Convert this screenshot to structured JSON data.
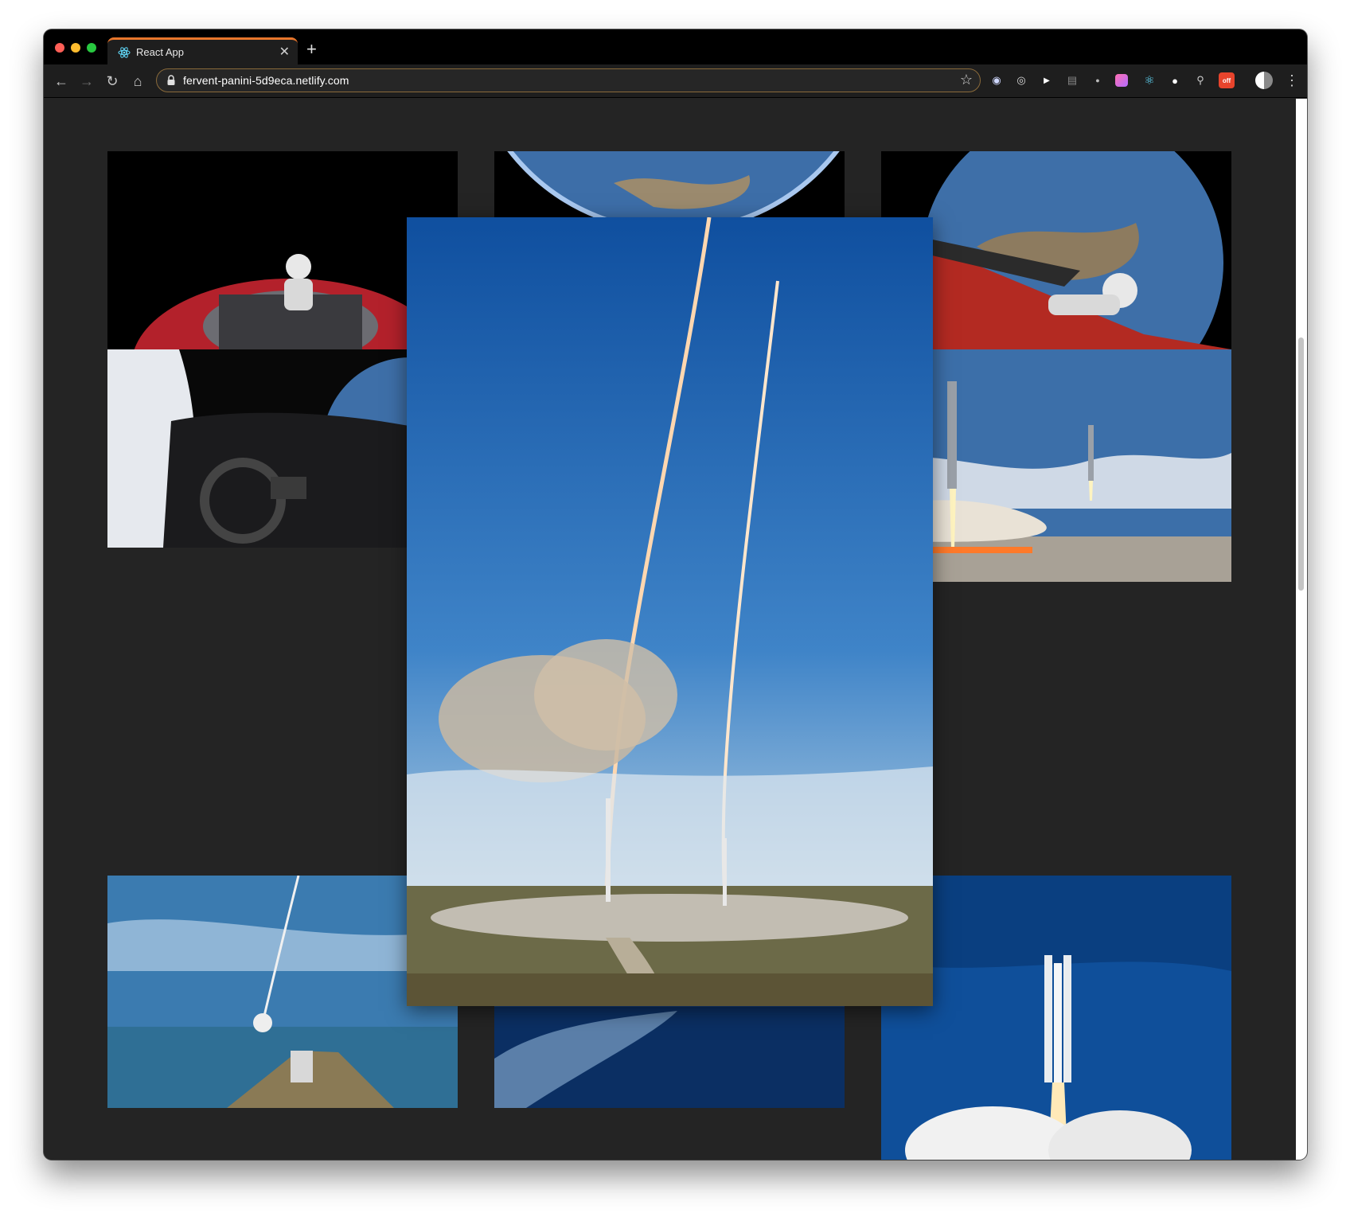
{
  "browser": {
    "tab": {
      "title": "React App",
      "close": "✕"
    },
    "new_tab": "+",
    "url": "fervent-panini-5d9eca.netlify.com",
    "nav": {
      "back": "←",
      "forward": "→",
      "reload": "↻",
      "home": "⌂",
      "bookmark": "☆",
      "menu": "⋮"
    },
    "extensions": [
      {
        "name": "owl-extension-icon",
        "glyph": "◉"
      },
      {
        "name": "podcast-extension-icon",
        "glyph": "◎"
      },
      {
        "name": "play-extension-icon",
        "glyph": "▶"
      },
      {
        "name": "list-extension-icon",
        "glyph": "▤"
      },
      {
        "name": "mouse-extension-icon",
        "glyph": "●"
      },
      {
        "name": "gradient-extension-icon",
        "glyph": ""
      },
      {
        "name": "react-devtools-icon",
        "glyph": "⚛"
      },
      {
        "name": "circle-extension-icon",
        "glyph": "●"
      },
      {
        "name": "pin-extension-icon",
        "glyph": "⚲"
      },
      {
        "name": "off-extension-icon",
        "glyph": "off"
      }
    ]
  },
  "gallery": {
    "tiles": [
      {
        "name": "roadster-crescent-earth-image"
      },
      {
        "name": "earth-from-space-image"
      },
      {
        "name": "roadster-over-earth-image"
      },
      {
        "name": "starman-dashboard-image"
      },
      {
        "name": "side-boosters-landing-image"
      },
      {
        "name": "launch-aerial-view-image"
      },
      {
        "name": "exhaust-plume-image"
      },
      {
        "name": "falcon-heavy-liftoff-image"
      }
    ],
    "expanded": {
      "name": "booster-landing-trails-image"
    }
  },
  "colors": {
    "page_bg": "#242424",
    "tab_accent": "#e8762b",
    "omnibox_border": "#8a6a3a"
  }
}
